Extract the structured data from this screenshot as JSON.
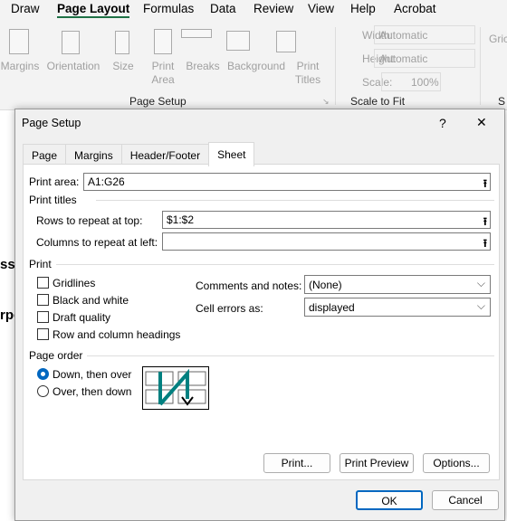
{
  "menu": {
    "tabs": [
      "Draw",
      "Page Layout",
      "Formulas",
      "Data",
      "Review",
      "View",
      "Help",
      "Acrobat"
    ],
    "active": "Page Layout"
  },
  "ribbon": {
    "page_setup": {
      "buttons": [
        "Margins",
        "Orientation",
        "Size",
        "Print Area",
        "Breaks",
        "Background",
        "Print Titles"
      ],
      "group_label": "Page Setup"
    },
    "scale_to_fit": {
      "width_label": "Width:",
      "width_value": "Automatic",
      "height_label": "Height:",
      "height_value": "Automatic",
      "scale_label": "Scale:",
      "scale_value": "100%",
      "group_label": "Scale to Fit"
    },
    "sheet_options_partial": {
      "label": "Gric",
      "group_label": "S"
    }
  },
  "sheet_fragments": [
    "ss",
    "rpo"
  ],
  "dialog": {
    "title": "Page Setup",
    "help": "?",
    "close": "✕",
    "tabs": [
      "Page",
      "Margins",
      "Header/Footer",
      "Sheet"
    ],
    "active_tab": "Sheet",
    "print_area_label": "Print area:",
    "print_area_value": "A1:G26",
    "print_titles_label": "Print titles",
    "rows_label": "Rows to repeat at top:",
    "rows_value": "$1:$2",
    "cols_label": "Columns to repeat at left:",
    "cols_value": "",
    "print_label": "Print",
    "checkboxes": [
      {
        "label": "Gridlines",
        "checked": false
      },
      {
        "label": "Black and white",
        "checked": false
      },
      {
        "label": "Draft quality",
        "checked": false
      },
      {
        "label": "Row and column headings",
        "checked": false
      }
    ],
    "comments_label": "Comments and notes:",
    "comments_value": "(None)",
    "errors_label": "Cell errors as:",
    "errors_value": "displayed",
    "page_order_label": "Page order",
    "radios": [
      {
        "label": "Down, then over",
        "selected": true
      },
      {
        "label": "Over, then down",
        "selected": false
      }
    ],
    "buttons": {
      "print": "Print...",
      "preview": "Print Preview",
      "options": "Options...",
      "ok": "OK",
      "cancel": "Cancel"
    },
    "accent": "#0067c0"
  }
}
